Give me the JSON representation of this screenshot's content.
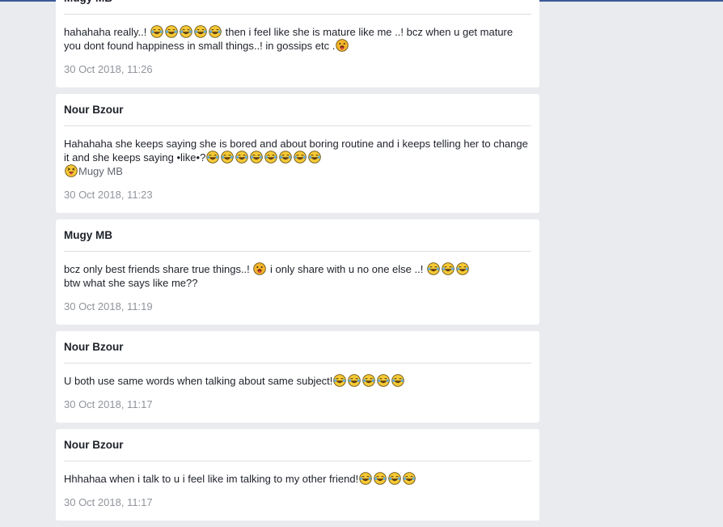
{
  "posts": [
    {
      "author": "Mugy MB",
      "lines": [
        [
          {
            "t": "hahahaha really..! "
          },
          {
            "e": "joy"
          },
          {
            "e": "joy"
          },
          {
            "e": "joy"
          },
          {
            "e": "joy"
          },
          {
            "e": "joy"
          },
          {
            "t": " then i feel like she is mature like me ..! bcz when u get mature"
          }
        ],
        [
          {
            "t": "you dont found happiness in small things..! in gossips etc ."
          },
          {
            "e": "tongue"
          }
        ]
      ],
      "time": "30 Oct 2018, 11:26"
    },
    {
      "author": "Nour Bzour",
      "lines": [
        [
          {
            "t": "Hahahaha she keeps saying she is bored and about boring routine and i keeps telling her to change"
          }
        ],
        [
          {
            "t": "it and she keeps saying •like•?"
          },
          {
            "e": "joy"
          },
          {
            "e": "joy"
          },
          {
            "e": "joy"
          },
          {
            "e": "joy"
          },
          {
            "e": "joy"
          },
          {
            "e": "joy"
          },
          {
            "e": "joy"
          },
          {
            "e": "joy"
          }
        ],
        [
          {
            "e": "squint"
          },
          {
            "m": "Mugy MB"
          }
        ]
      ],
      "time": "30 Oct 2018, 11:23"
    },
    {
      "author": "Mugy MB",
      "lines": [
        [
          {
            "t": "bcz only best friends share true things..! "
          },
          {
            "e": "tongue"
          },
          {
            "t": " i only share with u no one else ..! "
          },
          {
            "e": "joy"
          },
          {
            "e": "joy"
          },
          {
            "e": "joy"
          }
        ],
        [
          {
            "t": "btw what she says like me??"
          }
        ]
      ],
      "time": "30 Oct 2018, 11:19"
    },
    {
      "author": "Nour Bzour",
      "lines": [
        [
          {
            "t": "U both use same words when talking about same subject!"
          },
          {
            "e": "joy"
          },
          {
            "e": "joy"
          },
          {
            "e": "joy"
          },
          {
            "e": "joy"
          },
          {
            "e": "joy"
          }
        ]
      ],
      "time": "30 Oct 2018, 11:17"
    },
    {
      "author": "Nour Bzour",
      "lines": [
        [
          {
            "t": "Hhhahaa when i talk to u i feel like im talking to my other friend!"
          },
          {
            "e": "joy"
          },
          {
            "e": "joy"
          },
          {
            "e": "joy"
          },
          {
            "e": "joy"
          }
        ]
      ],
      "time": "30 Oct 2018, 11:17"
    }
  ],
  "colors": {
    "page_background": "#e9ebee",
    "card_background": "#ffffff",
    "divider": "#dddfe2",
    "timestamp": "#90949c",
    "top_bar": "#3b5998"
  }
}
